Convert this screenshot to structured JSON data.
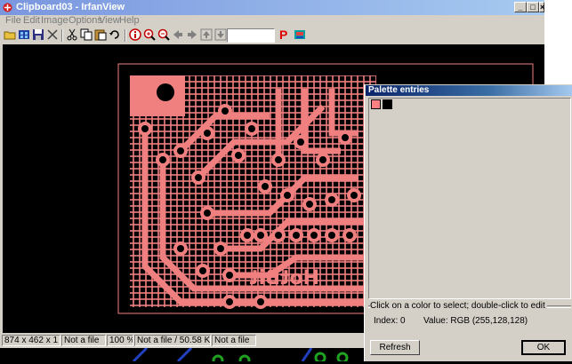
{
  "window": {
    "title": "Clipboard03 - IrfanView",
    "caption_buttons": {
      "minimize": "_",
      "maximize": "□",
      "close": "×"
    }
  },
  "menu": [
    "File",
    "Edit",
    "Image",
    "Options",
    "View",
    "Help"
  ],
  "toolbar": {
    "icons": [
      "open-icon",
      "thumbnails-icon",
      "save-icon",
      "delete-icon",
      "cut-icon",
      "copy-icon",
      "paste-icon",
      "undo-icon",
      "info-icon",
      "zoom-in-icon",
      "zoom-out-icon",
      "prev-icon",
      "next-icon",
      "first-icon",
      "last-icon",
      "print-icon",
      "settings-icon"
    ],
    "zoom_value": "",
    "print_label": "P"
  },
  "image": {
    "board_text": "HotBit",
    "colors": {
      "trace": "#f08080",
      "background": "#000000"
    }
  },
  "statusbar": [
    "874 x 462 x 1 BPP",
    "Not a file",
    "100 %",
    "Not a file / 50.58 KB",
    "Not a file"
  ],
  "palette_dialog": {
    "title": "Palette entries",
    "swatches": [
      "#ff8080",
      "#000000"
    ],
    "hint": "Click on a color to select; double-click to edit",
    "index_label": "Index: 0",
    "value_label": "Value: RGB (255,128,128)",
    "refresh_label": "Refresh",
    "ok_label": "OK"
  }
}
